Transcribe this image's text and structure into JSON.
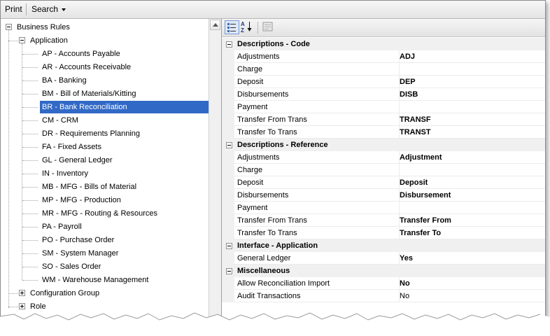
{
  "menubar": {
    "print_label": "Print",
    "search_label": "Search"
  },
  "tree": {
    "root": "Business Rules",
    "application": "Application",
    "items": [
      "AP - Accounts Payable",
      "AR - Accounts Receivable",
      "BA - Banking",
      "BM - Bill of Materials/Kitting",
      "BR - Bank Reconciliation",
      "CM - CRM",
      "DR - Requirements Planning",
      "FA - Fixed Assets",
      "GL - General Ledger",
      "IN - Inventory",
      "MB - MFG - Bills of Material",
      "MP - MFG - Production",
      "MR - MFG - Routing & Resources",
      "PA - Payroll",
      "PO - Purchase Order",
      "SM - System Manager",
      "SO - Sales Order",
      "WM - Warehouse Management"
    ],
    "selected_index": 4,
    "configuration_group": "Configuration Group",
    "role": "Role"
  },
  "grid": {
    "categories": [
      {
        "label": "Descriptions - Code",
        "rows": [
          {
            "name": "Adjustments",
            "value": "ADJ",
            "bold": true
          },
          {
            "name": "Charge",
            "value": "",
            "bold": true
          },
          {
            "name": "Deposit",
            "value": "DEP",
            "bold": true
          },
          {
            "name": "Disbursements",
            "value": "DISB",
            "bold": true
          },
          {
            "name": "Payment",
            "value": "",
            "bold": true
          },
          {
            "name": "Transfer From Trans",
            "value": "TRANSF",
            "bold": true
          },
          {
            "name": "Transfer To Trans",
            "value": "TRANST",
            "bold": true
          }
        ]
      },
      {
        "label": "Descriptions - Reference",
        "rows": [
          {
            "name": "Adjustments",
            "value": "Adjustment",
            "bold": true
          },
          {
            "name": "Charge",
            "value": "",
            "bold": true
          },
          {
            "name": "Deposit",
            "value": "Deposit",
            "bold": true
          },
          {
            "name": "Disbursements",
            "value": "Disbursement",
            "bold": true
          },
          {
            "name": "Payment",
            "value": "",
            "bold": true
          },
          {
            "name": "Transfer From Trans",
            "value": "Transfer From",
            "bold": true
          },
          {
            "name": "Transfer To Trans",
            "value": "Transfer To",
            "bold": true
          }
        ]
      },
      {
        "label": "Interface - Application",
        "rows": [
          {
            "name": "General Ledger",
            "value": "Yes",
            "bold": true
          }
        ]
      },
      {
        "label": "Miscellaneous",
        "rows": [
          {
            "name": "Allow Reconciliation Import",
            "value": "No",
            "bold": true
          },
          {
            "name": "Audit Transactions",
            "value": "No",
            "bold": false
          }
        ]
      }
    ]
  }
}
